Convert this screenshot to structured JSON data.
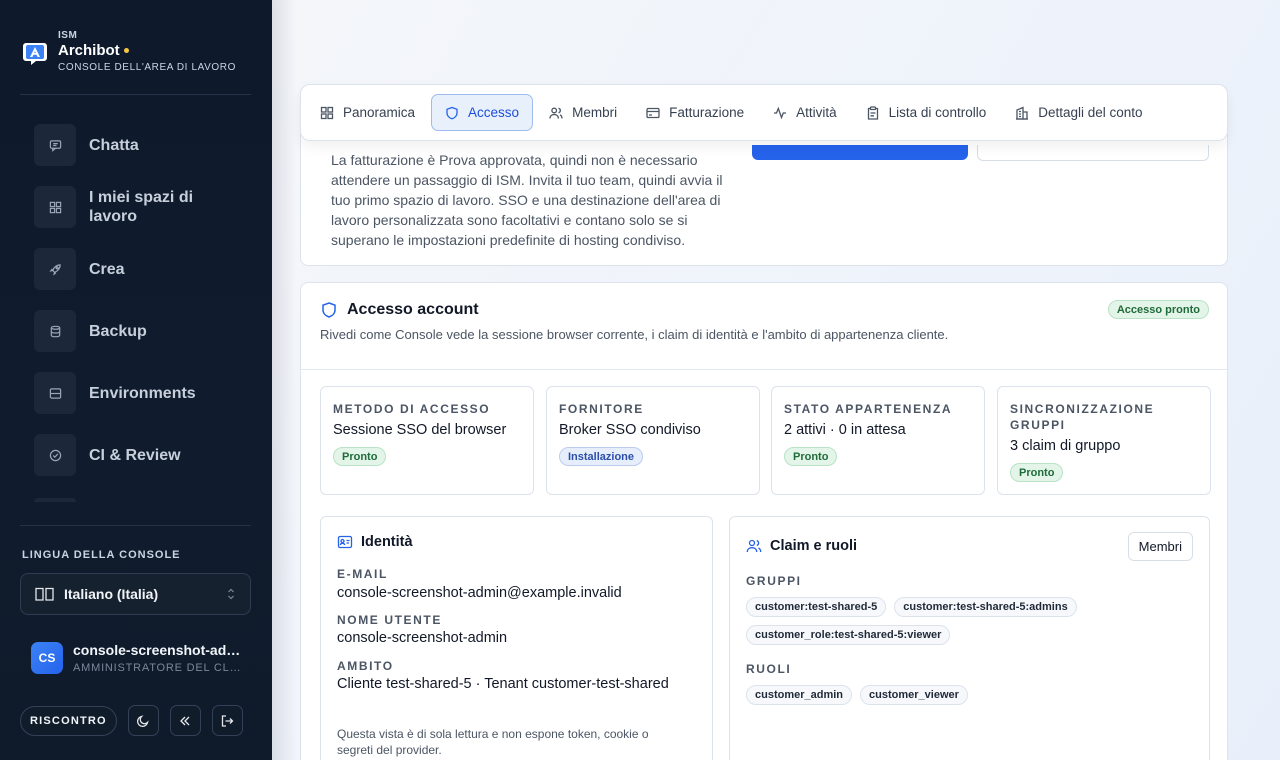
{
  "sidebar": {
    "brand_small": "ISM",
    "brand_name": "Archibot",
    "brand_sub": "CONSOLE DELL'AREA DI LAVORO",
    "nav": [
      {
        "label": "Chatta",
        "icon": "chat-icon"
      },
      {
        "label": "I miei spazi di lavoro",
        "icon": "grid-icon"
      },
      {
        "label": "Crea",
        "icon": "rocket-icon"
      },
      {
        "label": "Backup",
        "icon": "database-icon"
      },
      {
        "label": "Environments",
        "icon": "server-icon"
      },
      {
        "label": "CI & Review",
        "icon": "check-circle-icon"
      }
    ],
    "language_label": "LINGUA DELLA CONSOLE",
    "language_value": "Italiano (Italia)",
    "user_initials": "CS",
    "user_name": "console-screenshot-admin",
    "user_role": "AMMINISTRATORE DEL CLIENTE",
    "feedback_label": "RISCONTRO"
  },
  "tabs": [
    {
      "label": "Panoramica",
      "icon": "grid-icon"
    },
    {
      "label": "Accesso",
      "icon": "shield-icon",
      "active": true
    },
    {
      "label": "Membri",
      "icon": "users-icon"
    },
    {
      "label": "Fatturazione",
      "icon": "credit-card-icon"
    },
    {
      "label": "Attività",
      "icon": "activity-icon"
    },
    {
      "label": "Lista di controllo",
      "icon": "clipboard-icon"
    },
    {
      "label": "Dettagli del conto",
      "icon": "building-icon"
    }
  ],
  "top_card": {
    "text": "La fatturazione è Prova approvata, quindi non è necessario attendere un passaggio di ISM. Invita il tuo team, quindi avvia il tuo primo spazio di lavoro. SSO e una destinazione dell'area di lavoro personalizzata sono facoltativi e contano solo se si superano le impostazioni predefinite di hosting condiviso."
  },
  "access": {
    "title": "Accesso account",
    "subtitle": "Rivedi come Console vede la sessione browser corrente, i claim di identità e l'ambito di appartenenza cliente.",
    "badge": "Accesso pronto",
    "stats": [
      {
        "label": "METODO DI ACCESSO",
        "value": "Sessione SSO del browser",
        "badge": "Pronto",
        "tone": "green"
      },
      {
        "label": "FORNITORE",
        "value": "Broker SSO condiviso",
        "badge": "Installazione",
        "tone": "blue"
      },
      {
        "label": "STATO APPARTENENZA",
        "value": "2 attivi · 0 in attesa",
        "badge": "Pronto",
        "tone": "green"
      },
      {
        "label": "SINCRONIZZAZIONE GRUPPI",
        "value": "3 claim di gruppo",
        "badge": "Pronto",
        "tone": "green"
      }
    ],
    "identity": {
      "title": "Identità",
      "email_label": "E-MAIL",
      "email": "console-screenshot-admin@example.invalid",
      "username_label": "NOME UTENTE",
      "username": "console-screenshot-admin",
      "scope_label": "AMBITO",
      "scope": "Cliente test-shared-5 · Tenant customer-test-shared",
      "note": "Questa vista è di sola lettura e non espone token, cookie o segreti del provider."
    },
    "claims": {
      "title": "Claim e ruoli",
      "members_button": "Membri",
      "groups_label": "GRUPPI",
      "groups": [
        "customer:test-shared-5",
        "customer:test-shared-5:admins",
        "customer_role:test-shared-5:viewer"
      ],
      "roles_label": "RUOLI",
      "roles": [
        "customer_admin",
        "customer_viewer"
      ]
    }
  },
  "colors": {
    "sidebar_bg": "#0e1a2b",
    "accent": "#2563eb",
    "brand_dot": "#f5c542"
  }
}
